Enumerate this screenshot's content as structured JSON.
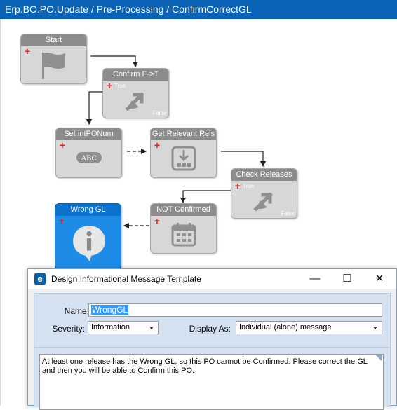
{
  "window": {
    "title": "Erp.BO.PO.Update / Pre-Processing / ConfirmCorrectGL"
  },
  "workflow": {
    "nodes": {
      "start": {
        "label": "Start",
        "icon": "flag-icon"
      },
      "confirm": {
        "label": "Confirm F->T",
        "icon": "condition-arrow-icon",
        "true_label": "True",
        "false_label": "False"
      },
      "set_intponum": {
        "label": "Set intPONum",
        "icon": "abc-variable-icon",
        "badge": "ABC"
      },
      "get_relevant_rels": {
        "label": "Get Relevant Rels",
        "icon": "fill-table-icon"
      },
      "check_releases": {
        "label": "Check Releases",
        "icon": "condition-arrow-icon",
        "true_label": "True",
        "false_label": "False"
      },
      "not_confirmed": {
        "label": "NOT Confirmed",
        "icon": "calendar-icon"
      },
      "wrong_gl": {
        "label": "Wrong GL",
        "icon": "info-bubble-icon",
        "selected": true
      }
    }
  },
  "dialog": {
    "title": "Design Informational Message Template",
    "logo_letter": "e",
    "buttons": {
      "minimize": "—",
      "maximize": "☐",
      "close": "✕"
    },
    "name_label": "Name:",
    "name_value": "WrongGL",
    "severity_label": "Severity:",
    "severity_value": "Information",
    "display_as_label": "Display As:",
    "display_as_value": "Individual (alone) message",
    "message_text": "At least one release has the Wrong GL, so this PO cannot be Confirmed.  Please correct the GL and then you will be able to Confirm this PO.",
    "accent_color": "#0a5fa6"
  },
  "colors": {
    "titlebar": "#0a63b6",
    "node_selected": "#1e8ce6",
    "node_default": "#d7d7d7"
  }
}
